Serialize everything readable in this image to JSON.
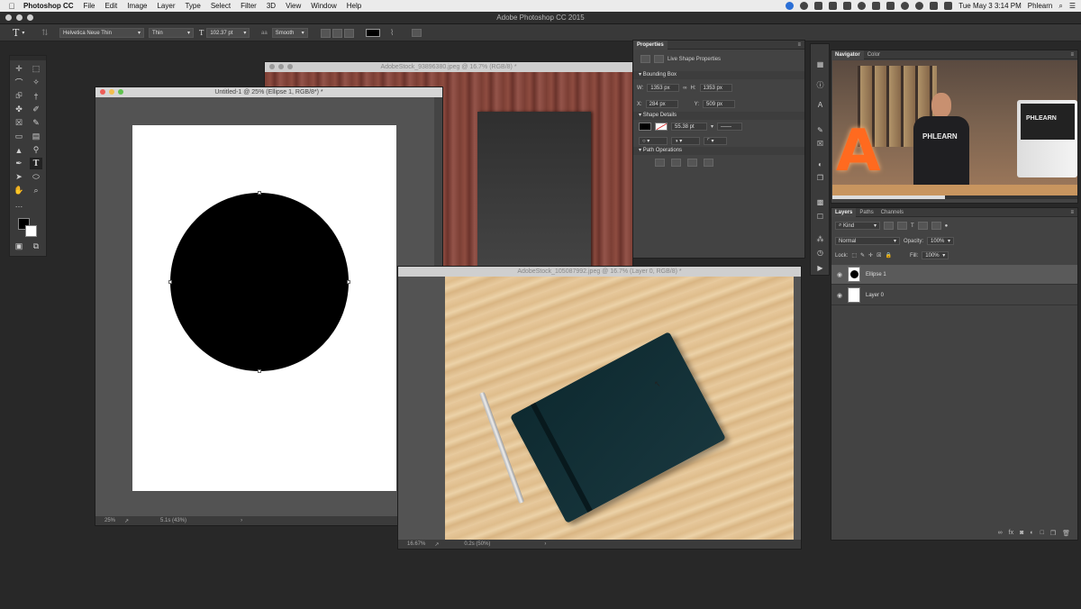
{
  "menubar": {
    "app_name": "Photoshop CC",
    "items": [
      "File",
      "Edit",
      "Image",
      "Layer",
      "Type",
      "Select",
      "Filter",
      "3D",
      "View",
      "Window",
      "Help"
    ],
    "clock": "Tue May 3  3:14 PM",
    "user": "Phlearn"
  },
  "app_title": "Adobe Photoshop CC 2015",
  "options_bar": {
    "font_family": "Helvetica Neue Thin",
    "font_style": "Thin",
    "font_size": "102.37 pt",
    "antialias": "Smooth"
  },
  "documents": {
    "untitled": {
      "title": "Untitled-1 @ 25% (Ellipse 1, RGB/8*) *",
      "zoom": "25%",
      "status": "5.1s (43%)"
    },
    "wood": {
      "title": "AdobeStock_93896380.jpeg @ 16.7% (RGB/8) *"
    },
    "notebook": {
      "title": "AdobeStock_105087992.jpeg @ 16.7% (Layer 0, RGB/8) *",
      "zoom": "16.67%",
      "status": "0.2s (50%)"
    }
  },
  "properties": {
    "tab": "Properties",
    "header": "Live Shape Properties",
    "bounding_box": "Bounding Box",
    "w_label": "W:",
    "w_value": "1353 px",
    "h_label": "H:",
    "h_value": "1353 px",
    "x_label": "X:",
    "x_value": "284 px",
    "y_label": "Y:",
    "y_value": "509 px",
    "shape_details": "Shape Details",
    "stroke_width": "55.38 pt",
    "path_operations": "Path Operations"
  },
  "navigator": {
    "tabs": [
      "Navigator",
      "Color"
    ]
  },
  "layers_panel": {
    "tabs": [
      "Layers",
      "Paths",
      "Channels"
    ],
    "filter": "Kind",
    "blend_mode": "Normal",
    "opacity_label": "Opacity:",
    "opacity": "100%",
    "lock_label": "Lock:",
    "fill_label": "Fill:",
    "fill": "100%",
    "layers": [
      {
        "name": "Ellipse 1",
        "selected": true
      },
      {
        "name": "Layer 0",
        "selected": false
      }
    ]
  },
  "video_overlay": {
    "shirt_text": "PHLEARN",
    "monitor_text": "PHLEARN"
  }
}
